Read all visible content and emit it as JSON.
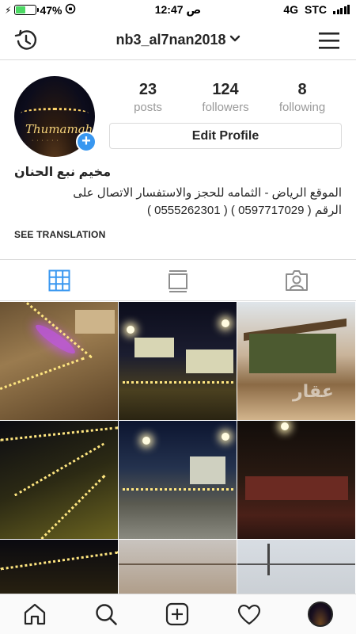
{
  "status_bar": {
    "battery_percent": "47%",
    "battery_level": 0.47,
    "time": "12:47 ص",
    "network": "4G",
    "carrier": "STC"
  },
  "header": {
    "username": "nb3_al7nan2018",
    "icons": {
      "left": "history-icon",
      "dropdown": "chevron-down-icon",
      "right": "menu-icon"
    }
  },
  "profile": {
    "avatar_text": "Thumamah",
    "stats": [
      {
        "value": "23",
        "label": "posts"
      },
      {
        "value": "124",
        "label": "followers"
      },
      {
        "value": "8",
        "label": "following"
      }
    ],
    "edit_button": "Edit Profile",
    "name": "مخيم نبع الحنان",
    "bio_line1": "الموقع الرياض - الثمامه للحجز والاستفسار الاتصال على",
    "bio_line2": "الرقم ( 0597717029 ) ( 0555262301 )",
    "see_translation": "SEE TRANSLATION"
  },
  "view_tabs": [
    {
      "name": "grid-view",
      "icon": "grid-icon",
      "active": true
    },
    {
      "name": "feed-view",
      "icon": "feed-icon",
      "active": false
    },
    {
      "name": "tagged-view",
      "icon": "tagged-user-icon",
      "active": false
    }
  ],
  "grid": {
    "photo_count_visible": 9,
    "watermark": "عقار"
  },
  "bottom_nav": [
    {
      "name": "home",
      "icon": "home-icon"
    },
    {
      "name": "search",
      "icon": "search-icon"
    },
    {
      "name": "new-post",
      "icon": "add-post-icon"
    },
    {
      "name": "activity",
      "icon": "heart-icon"
    },
    {
      "name": "profile",
      "icon": "profile-avatar"
    }
  ],
  "colors": {
    "accent_blue": "#3897f0",
    "text": "#262626",
    "muted": "#999999",
    "border": "#dbdbdb",
    "battery_green": "#4cd964"
  }
}
